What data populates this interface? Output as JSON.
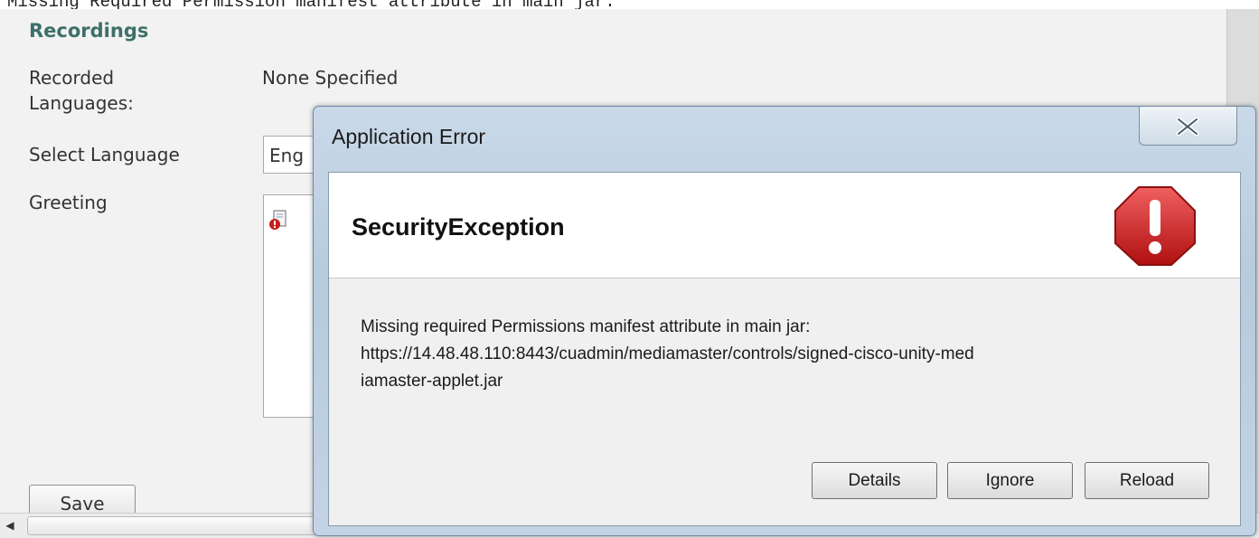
{
  "console": {
    "message": "Missing Required Permission manifest attribute in main jar."
  },
  "recordings": {
    "title": "Recordings",
    "recorded_languages_label": "Recorded Languages:",
    "recorded_languages_value": "None Specified",
    "select_language_label": "Select Language",
    "select_language_value": "Eng",
    "greeting_label": "Greeting",
    "save_label": "Save"
  },
  "dialog": {
    "title": "Application Error",
    "exception": "SecurityException",
    "message_lines": [
      "Missing required Permissions manifest attribute in main jar:",
      "https://14.48.48.110:8443/cuadmin/mediamaster/controls/signed-cisco-unity-med",
      "iamaster-applet.jar"
    ],
    "buttons": {
      "details": "Details",
      "ignore": "Ignore",
      "reload": "Reload"
    }
  },
  "icons": {
    "close": "close-icon",
    "error": "stop-error-icon",
    "greeting_file": "file-error-icon",
    "scroll_left": "chevron-left-icon"
  },
  "colors": {
    "section_title": "#3d7068",
    "error_icon": "#cc1f1f",
    "dialog_frame": "#b7cbde"
  }
}
